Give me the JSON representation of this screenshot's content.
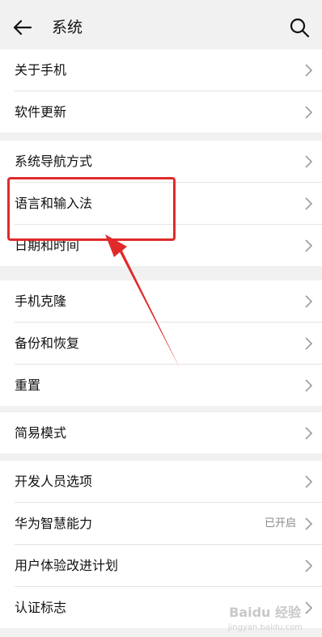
{
  "header": {
    "title": "系统"
  },
  "groups": [
    {
      "items": [
        {
          "label": "关于手机"
        },
        {
          "label": "软件更新"
        }
      ]
    },
    {
      "items": [
        {
          "label": "系统导航方式"
        },
        {
          "label": "语言和输入法"
        },
        {
          "label": "日期和时间"
        }
      ]
    },
    {
      "items": [
        {
          "label": "手机克隆"
        },
        {
          "label": "备份和恢复"
        },
        {
          "label": "重置"
        }
      ]
    },
    {
      "items": [
        {
          "label": "简易模式"
        }
      ]
    },
    {
      "items": [
        {
          "label": "开发人员选项"
        },
        {
          "label": "华为智慧能力",
          "status": "已开启"
        },
        {
          "label": "用户体验改进计划"
        },
        {
          "label": "认证标志"
        }
      ]
    }
  ],
  "watermark": {
    "text": "Baidu 经验",
    "sub": "jingyan.baidu.com"
  },
  "colors": {
    "highlight": "#e02a2a",
    "background": "#f1f1f1"
  }
}
